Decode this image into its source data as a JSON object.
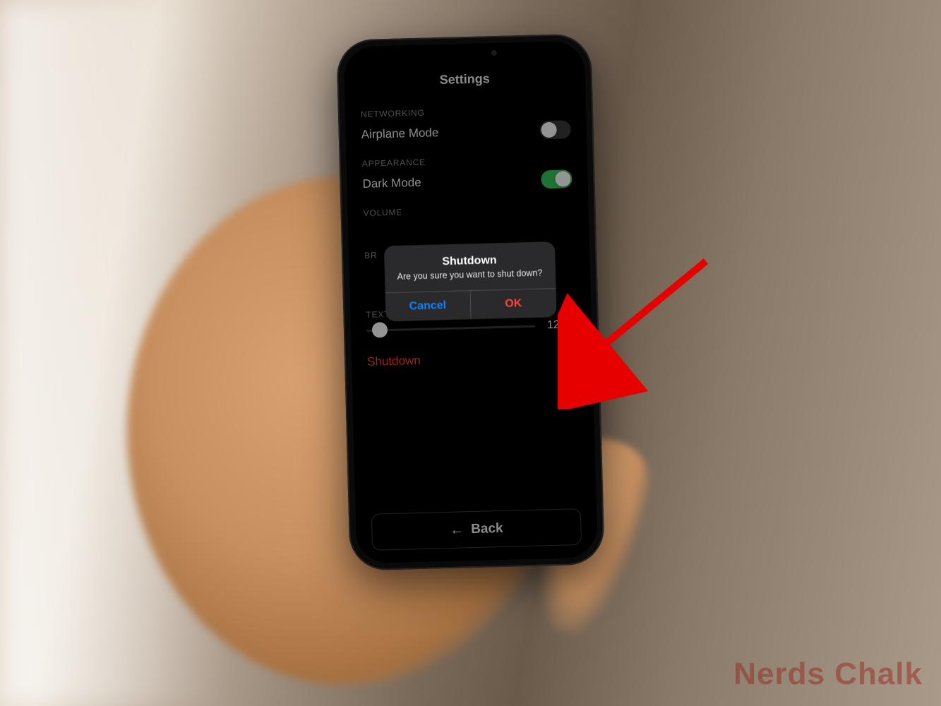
{
  "page": {
    "title": "Settings",
    "sections": {
      "networking": {
        "label": "NETWORKING",
        "airplane": {
          "label": "Airplane Mode",
          "on": false
        }
      },
      "appearance": {
        "label": "APPEARANCE",
        "darkmode": {
          "label": "Dark Mode",
          "on": true
        }
      },
      "volume": {
        "label": "VOLUME"
      },
      "brightness": {
        "label_prefix": "BR"
      },
      "textsize": {
        "label": "TEXT SIZE",
        "value": "120%",
        "position_pct": 8
      }
    },
    "shutdown_link": "Shutdown",
    "back": "Back"
  },
  "alert": {
    "title": "Shutdown",
    "message": "Are you sure you want to shut down?",
    "cancel": "Cancel",
    "ok": "OK"
  },
  "watermark": "Nerds Chalk"
}
